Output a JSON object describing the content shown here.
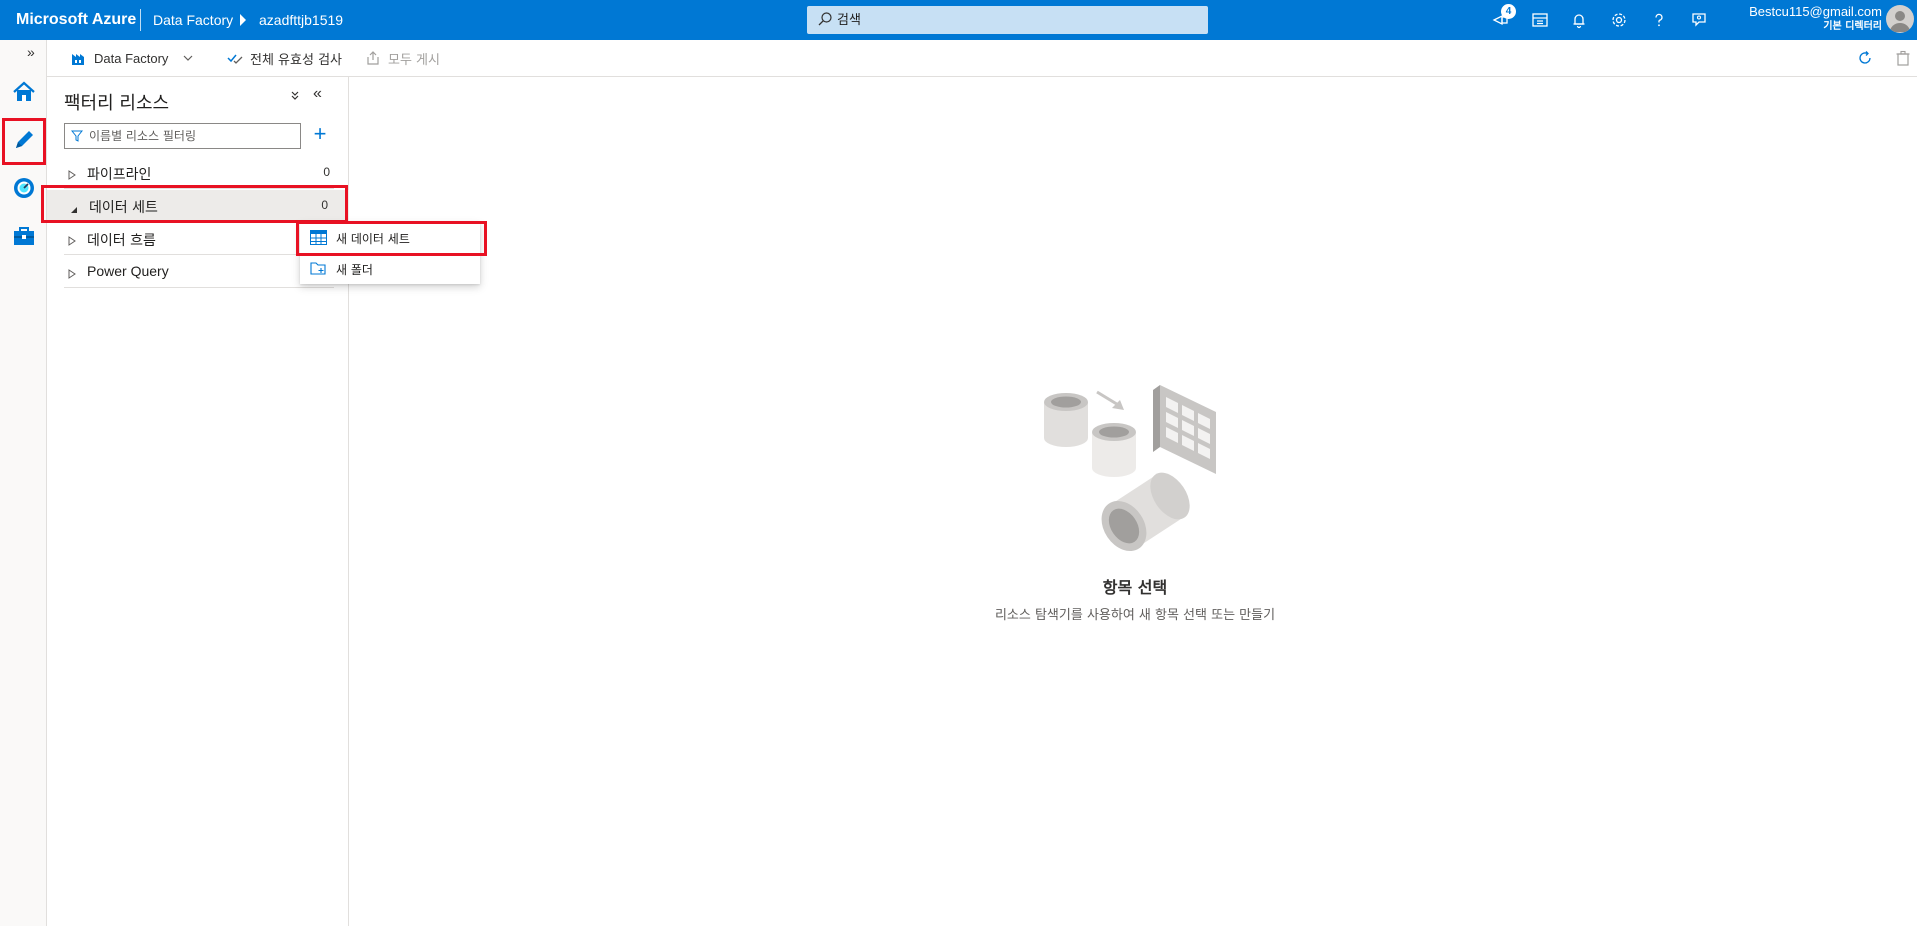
{
  "topbar": {
    "brand": "Microsoft Azure",
    "breadcrumb": [
      "Data Factory",
      "azadfttjb1519"
    ],
    "search_placeholder": "검색",
    "notification_count": "4",
    "account_email": "Bestcu115@gmail.com",
    "account_directory": "기본 디렉터리",
    "icons": [
      "feedback-icon",
      "directory-switch-icon",
      "bell-icon",
      "settings-icon",
      "help-icon",
      "support-icon"
    ]
  },
  "rail": {
    "expand_label": "»",
    "items": [
      {
        "name": "home",
        "icon": "home-icon"
      },
      {
        "name": "author",
        "icon": "pencil-icon",
        "highlighted": true
      },
      {
        "name": "monitor",
        "icon": "monitor-gauge-icon"
      },
      {
        "name": "manage",
        "icon": "toolbox-icon"
      }
    ]
  },
  "cmdbar": {
    "factory_label": "Data Factory",
    "validate_label": "전체 유효성 검사",
    "publish_label": "모두 게시"
  },
  "panel": {
    "title": "팩터리 리소스",
    "collapse_all": "⌄",
    "collapse_panel": "«",
    "filter_placeholder": "이름별 리소스 필터링",
    "add_label": "+",
    "tree": [
      {
        "label": "파이프라인",
        "count": "0",
        "expanded": false
      },
      {
        "label": "데이터 세트",
        "count": "0",
        "expanded": true,
        "selected": true
      },
      {
        "label": "데이터 흐름",
        "count": "",
        "expanded": false
      },
      {
        "label": "Power Query",
        "count": "",
        "expanded": false
      }
    ]
  },
  "context_menu": {
    "items": [
      {
        "label": "새 데이터 세트",
        "icon": "table-icon",
        "highlighted": true
      },
      {
        "label": "새 폴더",
        "icon": "new-folder-icon"
      }
    ]
  },
  "main": {
    "empty_title": "항목 선택",
    "empty_subtitle": "리소스 탐색기를 사용하여 새 항목 선택 또는 만들기"
  },
  "colors": {
    "azure_blue": "#0078d4",
    "highlight_red": "#e81123",
    "selected_row": "#edebe9"
  }
}
